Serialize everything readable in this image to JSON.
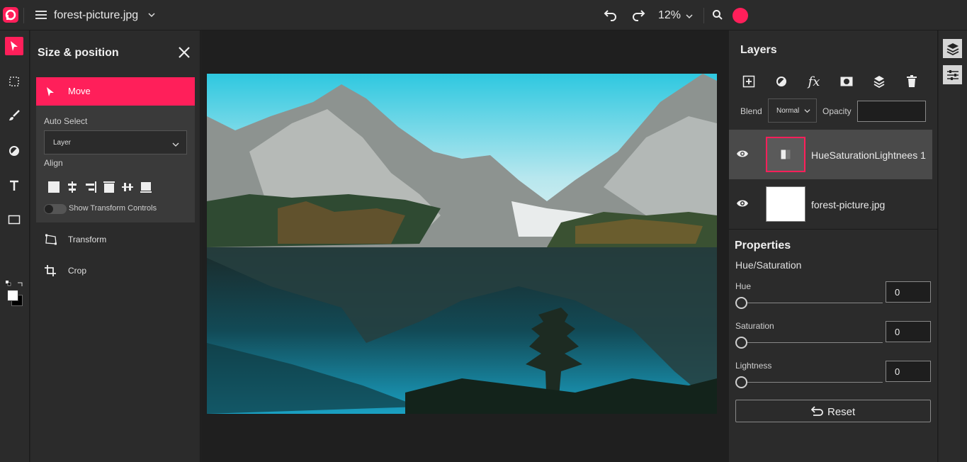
{
  "app": {
    "accent": "#ff1f5a"
  },
  "topbar": {
    "document_title": "forest-picture.jpg",
    "zoom": "12%",
    "icons": [
      "app-logo-icon",
      "menu-icon",
      "chevron-down-icon",
      "undo-icon",
      "redo-icon",
      "search-icon",
      "avatar"
    ]
  },
  "left_tools": [
    "move-tool-icon",
    "marquee-tool-icon",
    "brush-tool-icon",
    "adjust-tool-icon",
    "text-tool-icon",
    "shape-tool-icon",
    "swap-colors-icon"
  ],
  "tool_panel": {
    "title": "Size & position",
    "move_label": "Move",
    "auto_select_label": "Auto Select",
    "auto_select_value": "Layer",
    "align_label": "Align",
    "show_transform_label": "Show Transform Controls",
    "transform_label": "Transform",
    "crop_label": "Crop"
  },
  "layers_panel": {
    "title": "Layers",
    "blend_label": "Blend",
    "blend_value": "Normal",
    "opacity_label": "Opacity",
    "opacity_value": "",
    "layers": [
      {
        "name": "HueSaturationLightnees 1",
        "selected": true
      },
      {
        "name": "forest-picture.jpg",
        "selected": false
      }
    ]
  },
  "properties": {
    "title": "Properties",
    "subtitle": "Hue/Saturation",
    "hue_label": "Hue",
    "hue_value": "0",
    "saturation_label": "Saturation",
    "saturation_value": "0",
    "lightness_label": "Lightness",
    "lightness_value": "0",
    "reset_label": "Reset"
  }
}
